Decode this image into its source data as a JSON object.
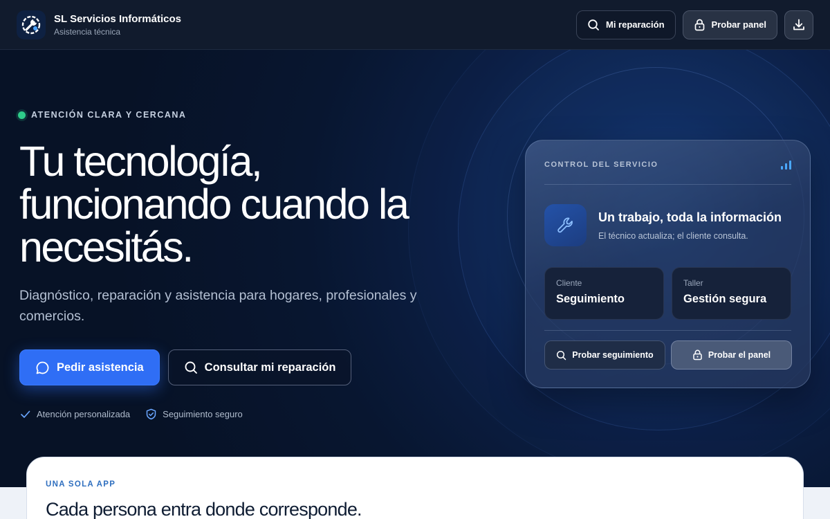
{
  "header": {
    "brand_name": "SL Servicios Informáticos",
    "brand_sub": "Asistencia técnica",
    "logo_icon": "wrench-gear-icon",
    "actions": [
      {
        "label": "Mi reparación",
        "icon": "search-icon"
      },
      {
        "label": "Probar panel",
        "icon": "lock-icon"
      },
      {
        "label": "",
        "icon": "download-icon"
      }
    ]
  },
  "hero": {
    "eyebrow": "ATENCIÓN CLARA Y CERCANA",
    "headline": [
      "Tu tecnología,",
      "funcionando cuando la",
      "necesitás."
    ],
    "lead": "Diagnóstico, reparación y asistencia para hogares, profesionales y comercios.",
    "cta_primary": "Pedir asistencia",
    "cta_secondary": "Consultar mi reparación",
    "trust": [
      "Atención personalizada",
      "Seguimiento seguro"
    ]
  },
  "card": {
    "eyebrow": "CONTROL DEL SERVICIO",
    "feature_title": "Un trabajo, toda la información",
    "feature_sub": "El técnico actualiza; el cliente consulta.",
    "tiles": [
      {
        "label": "Cliente",
        "value": "Seguimiento"
      },
      {
        "label": "Taller",
        "value": "Gestión segura"
      }
    ],
    "buttons": [
      {
        "label": "Probar seguimiento",
        "icon": "search-icon"
      },
      {
        "label": "Probar el panel",
        "icon": "lock-icon"
      }
    ]
  },
  "section": {
    "eyebrow": "UNA SOLA APP",
    "title": "Cada persona entra donde corresponde."
  },
  "colors": {
    "accent": "#2f6ef5",
    "status_dot": "#2ecc8a",
    "hero_bg": "#071429"
  }
}
